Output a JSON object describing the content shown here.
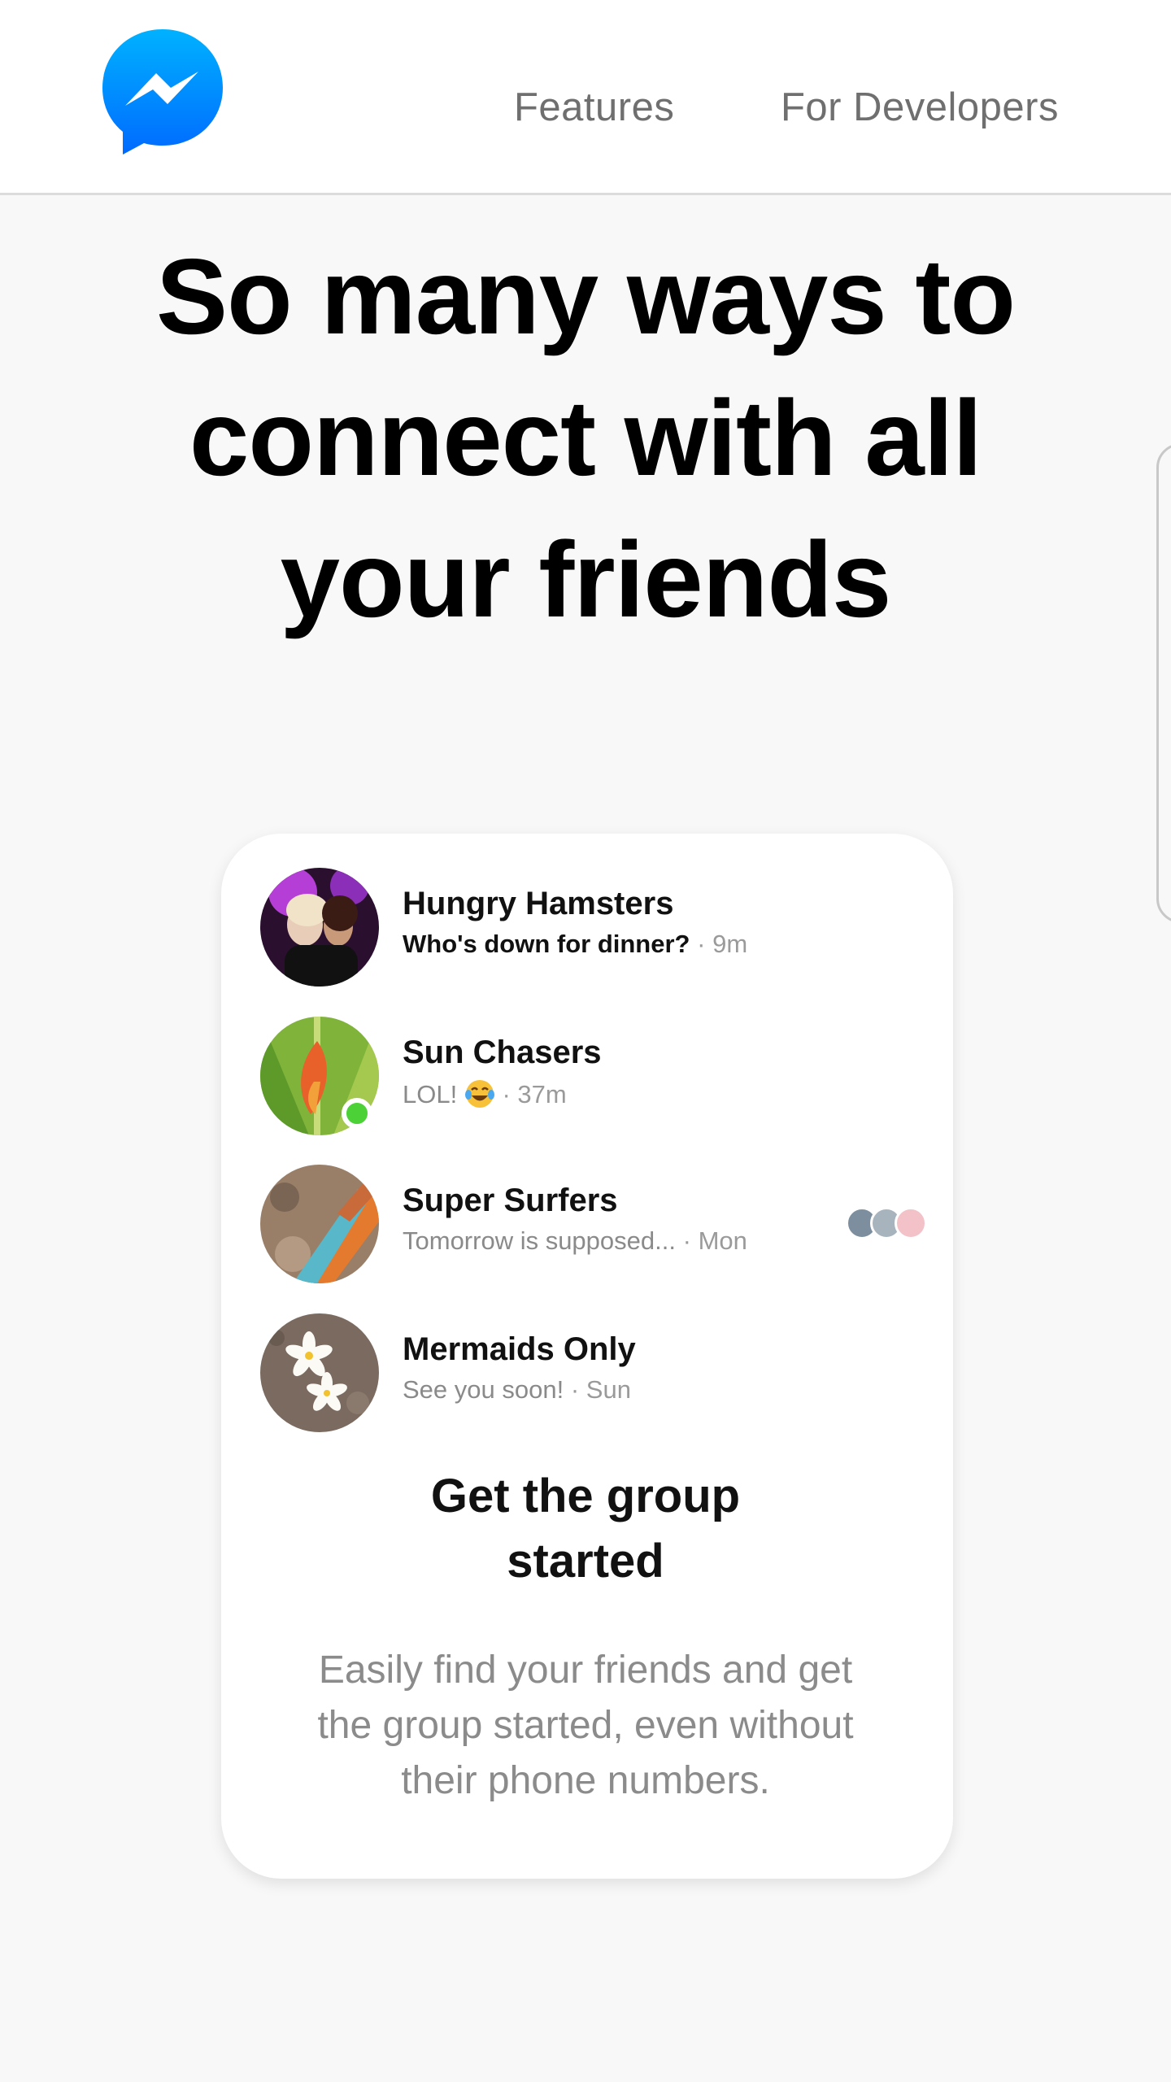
{
  "header": {
    "logo_alt": "Messenger",
    "nav": [
      {
        "label": "Features"
      },
      {
        "label": "For Developers"
      }
    ]
  },
  "hero": {
    "title_lines": [
      "So many ways to",
      "connect with all",
      "your friends"
    ]
  },
  "threads": [
    {
      "name": "Hungry Hamsters",
      "snippet": "Who's down for dinner?",
      "time": "9m",
      "unread": true
    },
    {
      "name": "Sun Chasers",
      "snippet": "LOL!",
      "emoji": "tears-of-joy",
      "time": "37m",
      "online": true
    },
    {
      "name": "Super Surfers",
      "snippet": "Tomorrow is supposed...",
      "time": "Mon",
      "seen_by_count": 3
    },
    {
      "name": "Mermaids Only",
      "snippet": "See you soon!",
      "time": "Sun"
    }
  ],
  "separator": "·",
  "feature": {
    "heading_lines": [
      "Get the group",
      "started"
    ],
    "description_lines": [
      "Easily find your friends and get",
      "the group started, even without",
      "their phone numbers."
    ]
  },
  "colors": {
    "brand_gradient": [
      "#00b2ff",
      "#006aff"
    ],
    "online": "#4cd137",
    "nav_text": "#6f6f6f",
    "muted_text": "#8b8b8b"
  },
  "icons": {
    "logo": "messenger-bolt-icon",
    "emoji": "face-with-tears-of-joy-icon"
  }
}
